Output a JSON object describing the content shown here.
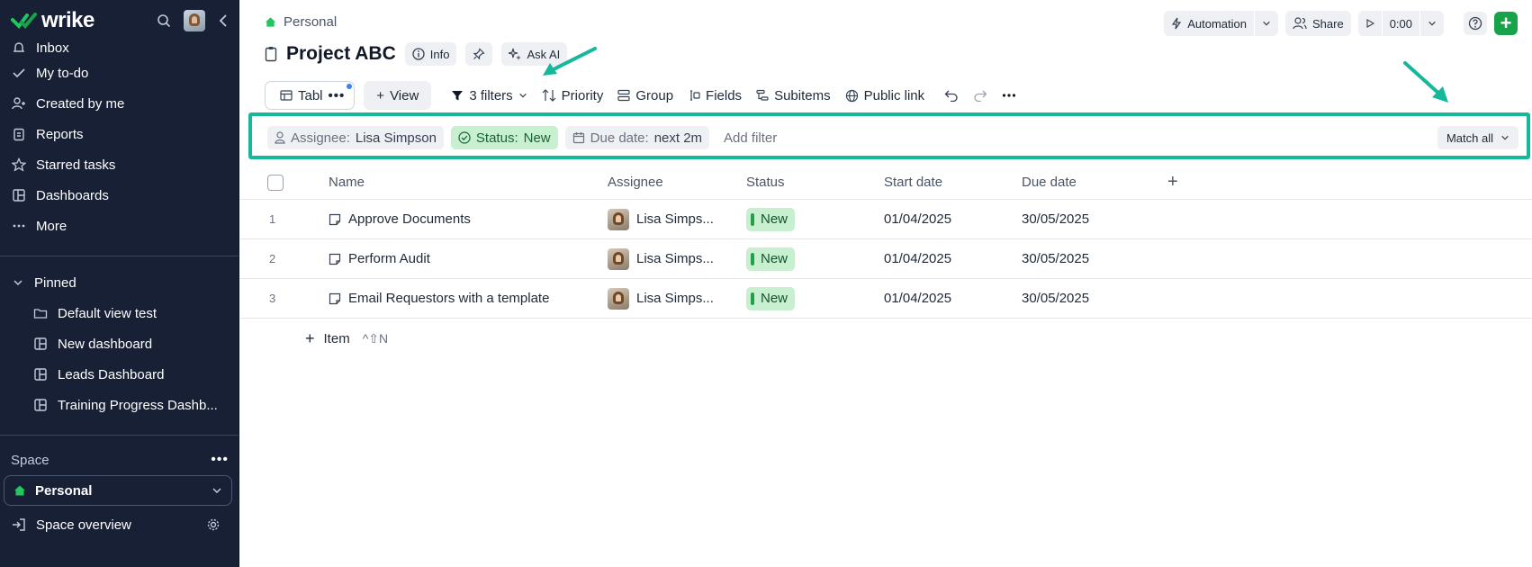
{
  "app": {
    "logo_text": "wrike",
    "brand_color": "#16a34a",
    "sidebar_bg": "#182036",
    "annotation_color": "#16b89a"
  },
  "sidebar": {
    "items": [
      {
        "label": "Inbox",
        "icon": "bell-icon"
      },
      {
        "label": "My to-do",
        "icon": "check-circle-icon"
      },
      {
        "label": "Created by me",
        "icon": "user-plus-icon"
      },
      {
        "label": "Reports",
        "icon": "clipboard-icon"
      },
      {
        "label": "Starred tasks",
        "icon": "star-icon"
      },
      {
        "label": "Dashboards",
        "icon": "dashboard-icon"
      },
      {
        "label": "More",
        "icon": "more-icon"
      }
    ],
    "pinned_label": "Pinned",
    "pinned": [
      {
        "label": "Default view test",
        "icon": "folder-icon"
      },
      {
        "label": "New dashboard",
        "icon": "dashboard-icon"
      },
      {
        "label": "Leads Dashboard",
        "icon": "dashboard-icon"
      },
      {
        "label": "Training Progress Dashb...",
        "icon": "dashboard-icon"
      }
    ],
    "space_label": "Space",
    "space_selected": "Personal",
    "space_overview": "Space overview"
  },
  "header": {
    "breadcrumb": "Personal",
    "title": "Project ABC",
    "info_label": "Info",
    "ask_ai_label": "Ask AI",
    "automation_label": "Automation",
    "share_label": "Share",
    "timer": "0:00"
  },
  "toolbar": {
    "view_tab": "Tabl",
    "add_view": "View",
    "filters": "3 filters",
    "priority": "Priority",
    "group": "Group",
    "fields": "Fields",
    "subitems": "Subitems",
    "public_link": "Public link"
  },
  "filters": {
    "assignee_key": "Assignee:",
    "assignee_value": "Lisa Simpson",
    "status_key": "Status:",
    "status_value": "New",
    "due_key": "Due date:",
    "due_value": "next 2m",
    "add_filter": "Add filter",
    "match": "Match all"
  },
  "table": {
    "columns": [
      "Name",
      "Assignee",
      "Status",
      "Start date",
      "Due date"
    ],
    "rows": [
      {
        "num": "1",
        "name": "Approve Documents",
        "assignee": "Lisa Simps...",
        "status": "New",
        "start": "01/04/2025",
        "due": "30/05/2025"
      },
      {
        "num": "2",
        "name": "Perform Audit",
        "assignee": "Lisa Simps...",
        "status": "New",
        "start": "01/04/2025",
        "due": "30/05/2025"
      },
      {
        "num": "3",
        "name": "Email Requestors with a template",
        "assignee": "Lisa Simps...",
        "status": "New",
        "start": "01/04/2025",
        "due": "30/05/2025"
      }
    ],
    "add_item": "Item",
    "add_item_shortcut": "^⇧N"
  }
}
